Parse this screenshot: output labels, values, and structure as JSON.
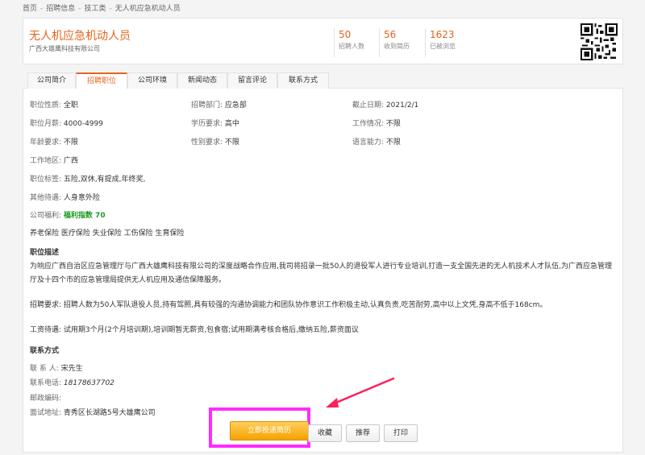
{
  "breadcrumb": {
    "items": [
      "首页",
      "招聘信息",
      "技工类",
      "无人机应急机动人员"
    ],
    "sep": "-"
  },
  "header": {
    "title": "无人机应急机动人员",
    "company": "广西大雄鹰科技有限公司",
    "stats": [
      {
        "num": "50",
        "label": "招聘人数"
      },
      {
        "num": "56",
        "label": "收到简历"
      },
      {
        "num": "1623",
        "label": "已被浏览"
      }
    ]
  },
  "tabs": [
    "公司简介",
    "招聘职位",
    "公司环境",
    "新闻动态",
    "留言评论",
    "联系方式"
  ],
  "details": {
    "nature_label": "职位性质:",
    "nature": "全职",
    "dept_label": "招聘部门:",
    "dept": "应急部",
    "deadline_label": "截止日期:",
    "deadline": "2021/2/1",
    "salary_label": "职位月薪:",
    "salary": "4000-4999",
    "edu_label": "学历要求:",
    "edu": "高中",
    "work_label": "工作情况:",
    "work": "不限",
    "age_label": "年龄要求:",
    "age": "不限",
    "gender_label": "性别要求:",
    "gender": "不限",
    "lang_label": "语言能力:",
    "lang": "不限",
    "area_label": "工作地区:",
    "area": "广西",
    "tags_label": "职位标签:",
    "tags": "五险,双休,有提成,年终奖,",
    "other_label": "其他待遇:",
    "other": "人身意外险",
    "welfare_label": "公司福利:",
    "welfare_index": "福利指数 70",
    "insurance": "养老保险 医疗保险 失业保险 工伤保险 生育保险"
  },
  "description": {
    "title": "职位描述",
    "p1": "为响应广西自治区应急管理厅与广西大雄鹰科技有限公司的深度战略合作应用,我司将招录一批50人的退役军人进行专业培训,打造一支全国先进的无人机技术人才队伍,为广西应急管理厅及十四个市的应急管理局提供无人机应用及通信保障服务。",
    "p2": "招聘要求: 招聘人数为50人军队退役人员,持有驾照,具有较强的沟通协调能力和团队协作意识工作积极主动,认真负责,吃苦耐劳,高中以上文凭,身高不低于168cm。",
    "p3": "工资待遇: 试用期3个月(2个月培训期),培训期暂无薪资,包食宿;试用期满考核合格后,缴纳五险,薪资面议"
  },
  "contact": {
    "title": "联系方式",
    "person_label": "联 系 人:",
    "person": "宋先生",
    "phone_label": "联系电话:",
    "phone": "18178637702",
    "zip_label": "邮政编码:",
    "zip": "",
    "addr_label": "面试地址:",
    "addr": "青秀区长湖路5号大雄鹰公司"
  },
  "actions": {
    "apply": "立即投递简历",
    "favorite": "收藏",
    "recommend": "推荐",
    "print": "打印"
  },
  "colors": {
    "accent": "#e8641b",
    "highlight_box": "#ff2bff",
    "welfare": "#1a9b21"
  }
}
